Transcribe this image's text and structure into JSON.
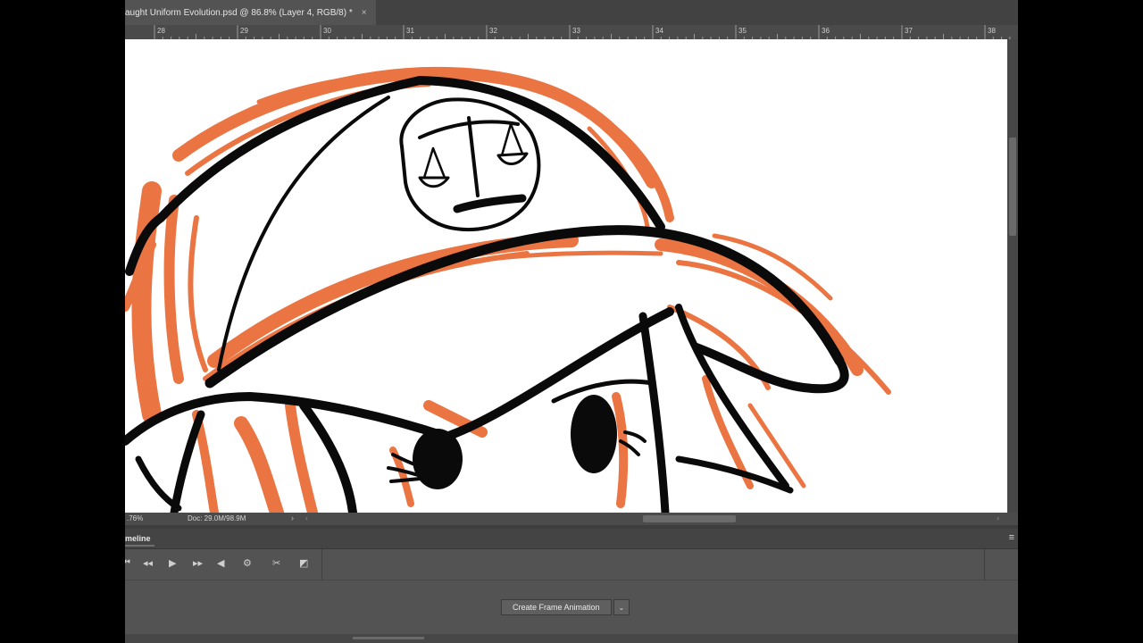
{
  "document_tab": {
    "title": "aught Uniform Evolution.psd @ 86.8% (Layer 4, RGB/8) *",
    "close_glyph": "×"
  },
  "ruler": {
    "labels": [
      "28",
      "29",
      "30",
      "31",
      "32",
      "33",
      "34",
      "35",
      "36",
      "37",
      "38"
    ]
  },
  "status": {
    "zoom": ".76%",
    "doc_size": "Doc: 29.0M/98.9M",
    "arrow": "›",
    "scroll_left": "‹",
    "scroll_right": "›"
  },
  "timeline": {
    "title": "meline",
    "menu_icon": "≡",
    "controls": {
      "first_frame": "⏮",
      "prev_frame": "◂◂",
      "play": "▶",
      "next_frame": "▸▸",
      "audio": "◀",
      "settings": "⚙",
      "split": "✂",
      "transition": "◩"
    },
    "create_button": "Create Frame Animation",
    "create_caret": "⌄"
  },
  "colors": {
    "sketch_orange": "#e8622a",
    "ink": "#0a0a0a",
    "app_bg": "#535353"
  }
}
